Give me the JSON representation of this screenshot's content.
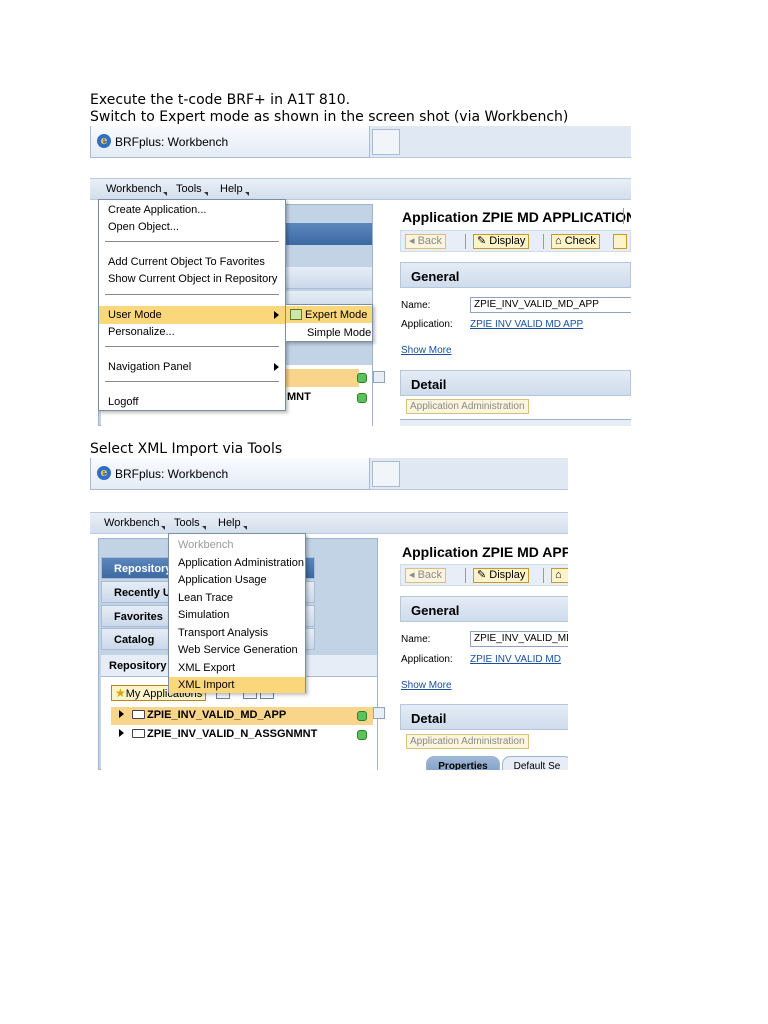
{
  "doc": {
    "line1": "Execute the t-code BRF+ in A1T 810.",
    "line2": "Switch to Expert mode as shown in the screen shot (via Workbench)",
    "line3": "Select XML Import via Tools"
  },
  "shot1": {
    "tab_title": "BRFplus: Workbench",
    "menubar": [
      "Workbench",
      "Tools",
      "Help"
    ],
    "workbench_menu": [
      "Create Application...",
      "Open Object...",
      "Add Current Object To Favorites",
      "Show Current Object in Repository",
      "User Mode",
      "Personalize...",
      "Navigation Panel",
      "Logoff"
    ],
    "user_mode_submenu": [
      "Expert Mode",
      "Simple Mode"
    ],
    "tree_partial_label": "MNT",
    "app_title": "Application ZPIE MD APPLICATION",
    "buttons": {
      "back": "Back",
      "display": "Display",
      "check": "Check"
    },
    "general": "General",
    "name_label": "Name:",
    "name_value": "ZPIE_INV_VALID_MD_APP",
    "application_label": "Application:",
    "application_value": "ZPIE INV VALID MD APP",
    "show_more": "Show More",
    "detail": "Detail",
    "app_admin": "Application Administration"
  },
  "shot2": {
    "tab_title": "BRFplus: Workbench",
    "menubar": [
      "Workbench",
      "Tools",
      "Help"
    ],
    "nav_items": [
      "Repository",
      "Recently U",
      "Favorites",
      "Catalog"
    ],
    "repository_label": "Repository",
    "tools_menu": [
      "Workbench",
      "Application Administration",
      "Application Usage",
      "Lean Trace",
      "Simulation",
      "Transport Analysis",
      "Web Service Generation",
      "XML Export",
      "XML Import"
    ],
    "my_applications": "My Applications",
    "tree_items": [
      "ZPIE_INV_VALID_MD_APP",
      "ZPIE_INV_VALID_N_ASSGNMNT"
    ],
    "app_title": "Application ZPIE MD APPLIC",
    "buttons": {
      "back": "Back",
      "display": "Display"
    },
    "general": "General",
    "name_label": "Name:",
    "name_value": "ZPIE_INV_VALID_MD",
    "application_label": "Application:",
    "application_value": "ZPIE INV VALID MD",
    "show_more": "Show More",
    "detail": "Detail",
    "app_admin": "Application Administration",
    "tabs": [
      "Properties",
      "Default Se"
    ]
  }
}
